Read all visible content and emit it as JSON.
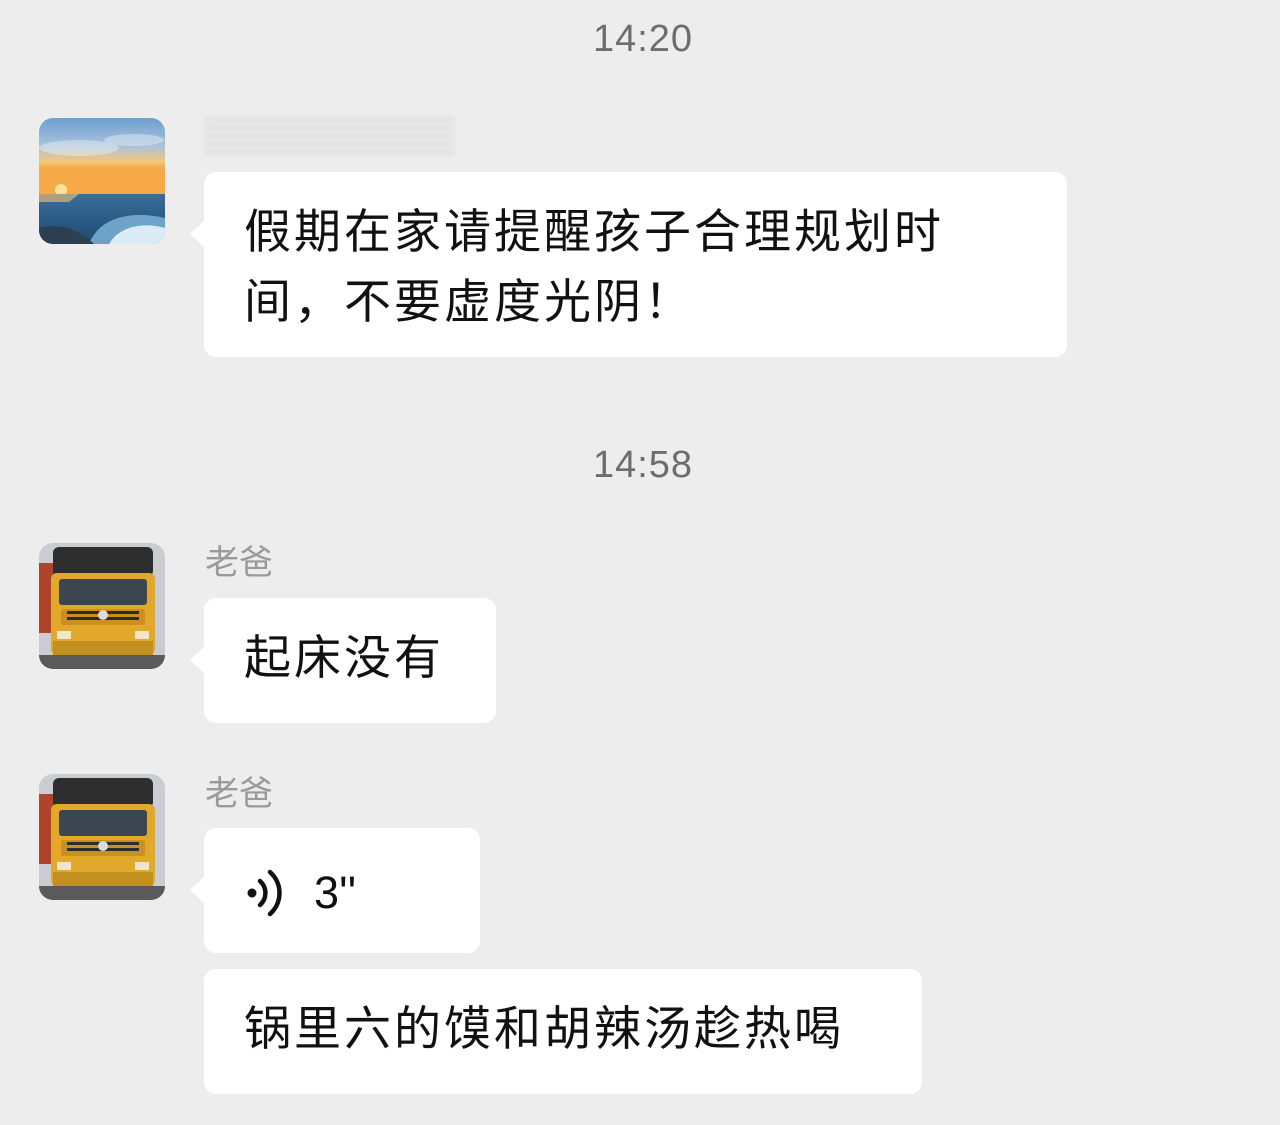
{
  "messages": {
    "time1": "14:20",
    "msg1": {
      "text": "假期在家请提醒孩子合理规划时间，不要虚度光阴！"
    },
    "time2": "14:58",
    "msg2": {
      "sender": "老爸",
      "text": "起床没有"
    },
    "msg3": {
      "sender": "老爸",
      "voice_duration": "3''"
    },
    "msg4": {
      "text": "锅里六的馍和胡辣汤趁热喝"
    }
  },
  "icons": {
    "voice": "voice-wave-icon",
    "avatar1": "sunset-ocean-avatar",
    "avatar2": "truck-avatar"
  },
  "colors": {
    "background": "#ededed",
    "bubble": "#ffffff",
    "text": "#111111",
    "meta": "#9a9a9a"
  }
}
